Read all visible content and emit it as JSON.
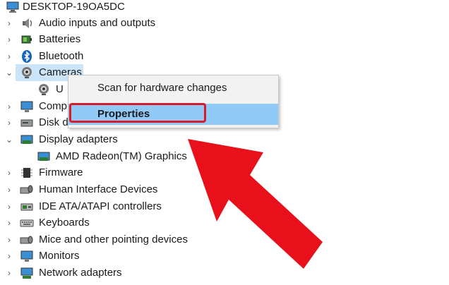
{
  "root": {
    "label": "DESKTOP-19OA5DC",
    "icon": "computer-icon"
  },
  "tree": [
    {
      "label": "Audio inputs and outputs",
      "icon": "speaker-icon",
      "state": "collapsed"
    },
    {
      "label": "Batteries",
      "icon": "battery-icon",
      "state": "collapsed"
    },
    {
      "label": "Bluetooth",
      "icon": "bluetooth-icon",
      "state": "collapsed"
    },
    {
      "label": "Cameras",
      "icon": "camera-icon",
      "state": "expanded",
      "selected": true
    },
    {
      "label": "U",
      "icon": "webcam-icon",
      "state": "leaf"
    },
    {
      "label": "Comp",
      "icon": "monitor-icon",
      "state": "collapsed"
    },
    {
      "label": "Disk d",
      "icon": "disk-drive-icon",
      "state": "collapsed"
    },
    {
      "label": "Display adapters",
      "icon": "display-adapter-icon",
      "state": "expanded"
    },
    {
      "label": "AMD Radeon(TM) Graphics",
      "icon": "display-adapter-icon",
      "state": "leaf"
    },
    {
      "label": "Firmware",
      "icon": "firmware-icon",
      "state": "collapsed"
    },
    {
      "label": "Human Interface Devices",
      "icon": "hid-icon",
      "state": "collapsed"
    },
    {
      "label": "IDE ATA/ATAPI controllers",
      "icon": "ide-controller-icon",
      "state": "collapsed"
    },
    {
      "label": "Keyboards",
      "icon": "keyboard-icon",
      "state": "collapsed"
    },
    {
      "label": "Mice and other pointing devices",
      "icon": "mouse-icon",
      "state": "collapsed"
    },
    {
      "label": "Monitors",
      "icon": "monitor-icon",
      "state": "collapsed"
    },
    {
      "label": "Network adapters",
      "icon": "network-adapter-icon",
      "state": "collapsed"
    }
  ],
  "context_menu": {
    "items": [
      {
        "label": "Scan for hardware changes"
      },
      {
        "label": "Properties",
        "highlighted": true
      }
    ]
  },
  "colors": {
    "selection": "#cce4f7",
    "menu_highlight": "#91c9f7",
    "annotation_red": "#e8101a"
  }
}
